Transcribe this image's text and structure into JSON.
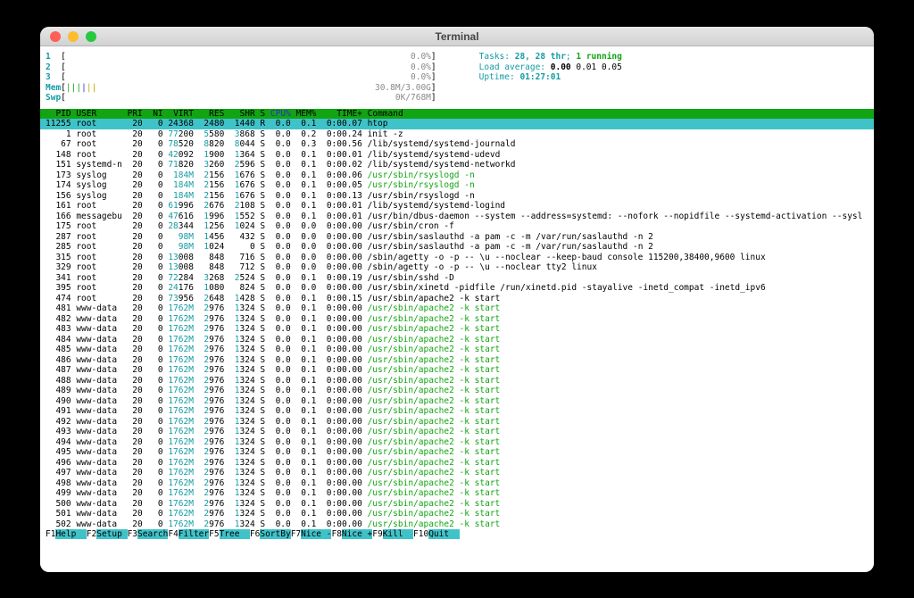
{
  "window": {
    "title": "Terminal"
  },
  "colors": {
    "green": "#13a413",
    "cyan_bg": "#3fc3c9",
    "cyan": "#149ba4",
    "gray": "#8a8a8a",
    "blue": "#2b2bd5",
    "yellow": "#c7a400",
    "t_red": "#ff5f57",
    "t_yellow": "#febc2e",
    "t_green": "#28c840"
  },
  "meters": {
    "cpus": [
      {
        "label": "1",
        "value": "0.0%"
      },
      {
        "label": "2",
        "value": "0.0%"
      },
      {
        "label": "3",
        "value": "0.0%"
      }
    ],
    "mem": {
      "label": "Mem",
      "value": "30.8M/3.00G",
      "bars": [
        "green",
        "green",
        "green",
        "blue",
        "yellow",
        "yellow"
      ]
    },
    "swp": {
      "label": "Swp",
      "value": "0K/768M",
      "bars": []
    },
    "tasks": {
      "label": "Tasks: ",
      "count": "28, 28 thr",
      "sep": "; ",
      "running": "1 running"
    },
    "load": {
      "label": "Load average: ",
      "first": "0.00 ",
      "rest": "0.01 0.05"
    },
    "uptime": {
      "label": "Uptime: ",
      "value": "01:27:01"
    }
  },
  "table": {
    "sort_column": "cpu",
    "columns": [
      {
        "key": "pid",
        "label": "PID"
      },
      {
        "key": "user",
        "label": "USER"
      },
      {
        "key": "pri",
        "label": "PRI"
      },
      {
        "key": "ni",
        "label": "NI"
      },
      {
        "key": "virt",
        "label": "VIRT"
      },
      {
        "key": "res",
        "label": "RES"
      },
      {
        "key": "shr",
        "label": "SHR"
      },
      {
        "key": "s",
        "label": "S"
      },
      {
        "key": "cpu",
        "label": "CPU%"
      },
      {
        "key": "mem",
        "label": "MEM%"
      },
      {
        "key": "time",
        "label": "TIME+"
      },
      {
        "key": "cmd",
        "label": "Command"
      }
    ],
    "rows": [
      {
        "pid": "11255",
        "user": "root",
        "pri": "20",
        "ni": "0",
        "virt": "24368",
        "res": "2480",
        "shr": "1440",
        "s": "R",
        "cpu": "0.0",
        "mem": "0.1",
        "time": "0:00.07",
        "cmd": "htop",
        "selected": true
      },
      {
        "pid": "1",
        "user": "root",
        "pri": "20",
        "ni": "0",
        "virt": "77200",
        "res": "5580",
        "shr": "3868",
        "s": "S",
        "cpu": "0.0",
        "mem": "0.2",
        "time": "0:00.24",
        "cmd": "init -z"
      },
      {
        "pid": "67",
        "user": "root",
        "pri": "20",
        "ni": "0",
        "virt": "78520",
        "res": "8820",
        "shr": "8044",
        "s": "S",
        "cpu": "0.0",
        "mem": "0.3",
        "time": "0:00.56",
        "cmd": "/lib/systemd/systemd-journald"
      },
      {
        "pid": "148",
        "user": "root",
        "pri": "20",
        "ni": "0",
        "virt": "42092",
        "res": "1900",
        "shr": "1364",
        "s": "S",
        "cpu": "0.0",
        "mem": "0.1",
        "time": "0:00.01",
        "cmd": "/lib/systemd/systemd-udevd"
      },
      {
        "pid": "151",
        "user": "systemd-n",
        "pri": "20",
        "ni": "0",
        "virt": "71820",
        "res": "3260",
        "shr": "2596",
        "s": "S",
        "cpu": "0.0",
        "mem": "0.1",
        "time": "0:00.02",
        "cmd": "/lib/systemd/systemd-networkd"
      },
      {
        "pid": "173",
        "user": "syslog",
        "pri": "20",
        "ni": "0",
        "virt": "184M",
        "res": "2156",
        "shr": "1676",
        "s": "S",
        "cpu": "0.0",
        "mem": "0.1",
        "time": "0:00.06",
        "cmd": "/usr/sbin/rsyslogd -n",
        "cmd_green": true
      },
      {
        "pid": "174",
        "user": "syslog",
        "pri": "20",
        "ni": "0",
        "virt": "184M",
        "res": "2156",
        "shr": "1676",
        "s": "S",
        "cpu": "0.0",
        "mem": "0.1",
        "time": "0:00.05",
        "cmd": "/usr/sbin/rsyslogd -n",
        "cmd_green": true
      },
      {
        "pid": "156",
        "user": "syslog",
        "pri": "20",
        "ni": "0",
        "virt": "184M",
        "res": "2156",
        "shr": "1676",
        "s": "S",
        "cpu": "0.0",
        "mem": "0.1",
        "time": "0:00.13",
        "cmd": "/usr/sbin/rsyslogd -n"
      },
      {
        "pid": "161",
        "user": "root",
        "pri": "20",
        "ni": "0",
        "virt": "61996",
        "res": "2676",
        "shr": "2108",
        "s": "S",
        "cpu": "0.0",
        "mem": "0.1",
        "time": "0:00.01",
        "cmd": "/lib/systemd/systemd-logind"
      },
      {
        "pid": "166",
        "user": "messagebu",
        "pri": "20",
        "ni": "0",
        "virt": "47616",
        "res": "1996",
        "shr": "1552",
        "s": "S",
        "cpu": "0.0",
        "mem": "0.1",
        "time": "0:00.01",
        "cmd": "/usr/bin/dbus-daemon --system --address=systemd: --nofork --nopidfile --systemd-activation --sysl"
      },
      {
        "pid": "175",
        "user": "root",
        "pri": "20",
        "ni": "0",
        "virt": "28344",
        "res": "1256",
        "shr": "1024",
        "s": "S",
        "cpu": "0.0",
        "mem": "0.0",
        "time": "0:00.00",
        "cmd": "/usr/sbin/cron -f"
      },
      {
        "pid": "287",
        "user": "root",
        "pri": "20",
        "ni": "0",
        "virt": "98M",
        "res": "1456",
        "shr": "432",
        "s": "S",
        "cpu": "0.0",
        "mem": "0.0",
        "time": "0:00.00",
        "cmd": "/usr/sbin/saslauthd -a pam -c -m /var/run/saslauthd -n 2"
      },
      {
        "pid": "285",
        "user": "root",
        "pri": "20",
        "ni": "0",
        "virt": "98M",
        "res": "1024",
        "shr": "0",
        "s": "S",
        "cpu": "0.0",
        "mem": "0.0",
        "time": "0:00.00",
        "cmd": "/usr/sbin/saslauthd -a pam -c -m /var/run/saslauthd -n 2"
      },
      {
        "pid": "315",
        "user": "root",
        "pri": "20",
        "ni": "0",
        "virt": "13008",
        "res": "848",
        "shr": "716",
        "s": "S",
        "cpu": "0.0",
        "mem": "0.0",
        "time": "0:00.00",
        "cmd": "/sbin/agetty -o -p -- \\u --noclear --keep-baud console 115200,38400,9600 linux"
      },
      {
        "pid": "329",
        "user": "root",
        "pri": "20",
        "ni": "0",
        "virt": "13008",
        "res": "848",
        "shr": "712",
        "s": "S",
        "cpu": "0.0",
        "mem": "0.0",
        "time": "0:00.00",
        "cmd": "/sbin/agetty -o -p -- \\u --noclear tty2 linux"
      },
      {
        "pid": "341",
        "user": "root",
        "pri": "20",
        "ni": "0",
        "virt": "72284",
        "res": "3268",
        "shr": "2524",
        "s": "S",
        "cpu": "0.0",
        "mem": "0.1",
        "time": "0:00.19",
        "cmd": "/usr/sbin/sshd -D"
      },
      {
        "pid": "395",
        "user": "root",
        "pri": "20",
        "ni": "0",
        "virt": "24176",
        "res": "1080",
        "shr": "824",
        "s": "S",
        "cpu": "0.0",
        "mem": "0.0",
        "time": "0:00.00",
        "cmd": "/usr/sbin/xinetd -pidfile /run/xinetd.pid -stayalive -inetd_compat -inetd_ipv6"
      },
      {
        "pid": "474",
        "user": "root",
        "pri": "20",
        "ni": "0",
        "virt": "73956",
        "res": "2648",
        "shr": "1428",
        "s": "S",
        "cpu": "0.0",
        "mem": "0.1",
        "time": "0:00.15",
        "cmd": "/usr/sbin/apache2 -k start"
      },
      {
        "pid": "481",
        "user": "www-data",
        "pri": "20",
        "ni": "0",
        "virt": "1762M",
        "res": "2976",
        "shr": "1324",
        "s": "S",
        "cpu": "0.0",
        "mem": "0.1",
        "time": "0:00.00",
        "cmd": "/usr/sbin/apache2 -k start",
        "cmd_green": true
      },
      {
        "pid": "482",
        "user": "www-data",
        "pri": "20",
        "ni": "0",
        "virt": "1762M",
        "res": "2976",
        "shr": "1324",
        "s": "S",
        "cpu": "0.0",
        "mem": "0.1",
        "time": "0:00.00",
        "cmd": "/usr/sbin/apache2 -k start",
        "cmd_green": true
      },
      {
        "pid": "483",
        "user": "www-data",
        "pri": "20",
        "ni": "0",
        "virt": "1762M",
        "res": "2976",
        "shr": "1324",
        "s": "S",
        "cpu": "0.0",
        "mem": "0.1",
        "time": "0:00.00",
        "cmd": "/usr/sbin/apache2 -k start",
        "cmd_green": true
      },
      {
        "pid": "484",
        "user": "www-data",
        "pri": "20",
        "ni": "0",
        "virt": "1762M",
        "res": "2976",
        "shr": "1324",
        "s": "S",
        "cpu": "0.0",
        "mem": "0.1",
        "time": "0:00.00",
        "cmd": "/usr/sbin/apache2 -k start",
        "cmd_green": true
      },
      {
        "pid": "485",
        "user": "www-data",
        "pri": "20",
        "ni": "0",
        "virt": "1762M",
        "res": "2976",
        "shr": "1324",
        "s": "S",
        "cpu": "0.0",
        "mem": "0.1",
        "time": "0:00.00",
        "cmd": "/usr/sbin/apache2 -k start",
        "cmd_green": true
      },
      {
        "pid": "486",
        "user": "www-data",
        "pri": "20",
        "ni": "0",
        "virt": "1762M",
        "res": "2976",
        "shr": "1324",
        "s": "S",
        "cpu": "0.0",
        "mem": "0.1",
        "time": "0:00.00",
        "cmd": "/usr/sbin/apache2 -k start",
        "cmd_green": true
      },
      {
        "pid": "487",
        "user": "www-data",
        "pri": "20",
        "ni": "0",
        "virt": "1762M",
        "res": "2976",
        "shr": "1324",
        "s": "S",
        "cpu": "0.0",
        "mem": "0.1",
        "time": "0:00.00",
        "cmd": "/usr/sbin/apache2 -k start",
        "cmd_green": true
      },
      {
        "pid": "488",
        "user": "www-data",
        "pri": "20",
        "ni": "0",
        "virt": "1762M",
        "res": "2976",
        "shr": "1324",
        "s": "S",
        "cpu": "0.0",
        "mem": "0.1",
        "time": "0:00.00",
        "cmd": "/usr/sbin/apache2 -k start",
        "cmd_green": true
      },
      {
        "pid": "489",
        "user": "www-data",
        "pri": "20",
        "ni": "0",
        "virt": "1762M",
        "res": "2976",
        "shr": "1324",
        "s": "S",
        "cpu": "0.0",
        "mem": "0.1",
        "time": "0:00.00",
        "cmd": "/usr/sbin/apache2 -k start",
        "cmd_green": true
      },
      {
        "pid": "490",
        "user": "www-data",
        "pri": "20",
        "ni": "0",
        "virt": "1762M",
        "res": "2976",
        "shr": "1324",
        "s": "S",
        "cpu": "0.0",
        "mem": "0.1",
        "time": "0:00.00",
        "cmd": "/usr/sbin/apache2 -k start",
        "cmd_green": true
      },
      {
        "pid": "491",
        "user": "www-data",
        "pri": "20",
        "ni": "0",
        "virt": "1762M",
        "res": "2976",
        "shr": "1324",
        "s": "S",
        "cpu": "0.0",
        "mem": "0.1",
        "time": "0:00.00",
        "cmd": "/usr/sbin/apache2 -k start",
        "cmd_green": true
      },
      {
        "pid": "492",
        "user": "www-data",
        "pri": "20",
        "ni": "0",
        "virt": "1762M",
        "res": "2976",
        "shr": "1324",
        "s": "S",
        "cpu": "0.0",
        "mem": "0.1",
        "time": "0:00.00",
        "cmd": "/usr/sbin/apache2 -k start",
        "cmd_green": true
      },
      {
        "pid": "493",
        "user": "www-data",
        "pri": "20",
        "ni": "0",
        "virt": "1762M",
        "res": "2976",
        "shr": "1324",
        "s": "S",
        "cpu": "0.0",
        "mem": "0.1",
        "time": "0:00.00",
        "cmd": "/usr/sbin/apache2 -k start",
        "cmd_green": true
      },
      {
        "pid": "494",
        "user": "www-data",
        "pri": "20",
        "ni": "0",
        "virt": "1762M",
        "res": "2976",
        "shr": "1324",
        "s": "S",
        "cpu": "0.0",
        "mem": "0.1",
        "time": "0:00.00",
        "cmd": "/usr/sbin/apache2 -k start",
        "cmd_green": true
      },
      {
        "pid": "495",
        "user": "www-data",
        "pri": "20",
        "ni": "0",
        "virt": "1762M",
        "res": "2976",
        "shr": "1324",
        "s": "S",
        "cpu": "0.0",
        "mem": "0.1",
        "time": "0:00.00",
        "cmd": "/usr/sbin/apache2 -k start",
        "cmd_green": true
      },
      {
        "pid": "496",
        "user": "www-data",
        "pri": "20",
        "ni": "0",
        "virt": "1762M",
        "res": "2976",
        "shr": "1324",
        "s": "S",
        "cpu": "0.0",
        "mem": "0.1",
        "time": "0:00.00",
        "cmd": "/usr/sbin/apache2 -k start",
        "cmd_green": true
      },
      {
        "pid": "497",
        "user": "www-data",
        "pri": "20",
        "ni": "0",
        "virt": "1762M",
        "res": "2976",
        "shr": "1324",
        "s": "S",
        "cpu": "0.0",
        "mem": "0.1",
        "time": "0:00.00",
        "cmd": "/usr/sbin/apache2 -k start",
        "cmd_green": true
      },
      {
        "pid": "498",
        "user": "www-data",
        "pri": "20",
        "ni": "0",
        "virt": "1762M",
        "res": "2976",
        "shr": "1324",
        "s": "S",
        "cpu": "0.0",
        "mem": "0.1",
        "time": "0:00.00",
        "cmd": "/usr/sbin/apache2 -k start",
        "cmd_green": true
      },
      {
        "pid": "499",
        "user": "www-data",
        "pri": "20",
        "ni": "0",
        "virt": "1762M",
        "res": "2976",
        "shr": "1324",
        "s": "S",
        "cpu": "0.0",
        "mem": "0.1",
        "time": "0:00.00",
        "cmd": "/usr/sbin/apache2 -k start",
        "cmd_green": true
      },
      {
        "pid": "500",
        "user": "www-data",
        "pri": "20",
        "ni": "0",
        "virt": "1762M",
        "res": "2976",
        "shr": "1324",
        "s": "S",
        "cpu": "0.0",
        "mem": "0.1",
        "time": "0:00.00",
        "cmd": "/usr/sbin/apache2 -k start",
        "cmd_green": true
      },
      {
        "pid": "501",
        "user": "www-data",
        "pri": "20",
        "ni": "0",
        "virt": "1762M",
        "res": "2976",
        "shr": "1324",
        "s": "S",
        "cpu": "0.0",
        "mem": "0.1",
        "time": "0:00.00",
        "cmd": "/usr/sbin/apache2 -k start",
        "cmd_green": true
      },
      {
        "pid": "502",
        "user": "www-data",
        "pri": "20",
        "ni": "0",
        "virt": "1762M",
        "res": "2976",
        "shr": "1324",
        "s": "S",
        "cpu": "0.0",
        "mem": "0.1",
        "time": "0:00.00",
        "cmd": "/usr/sbin/apache2 -k start",
        "cmd_green": true
      }
    ]
  },
  "fkeys": [
    {
      "key": "F1",
      "label": "Help"
    },
    {
      "key": "F2",
      "label": "Setup"
    },
    {
      "key": "F3",
      "label": "Search"
    },
    {
      "key": "F4",
      "label": "Filter"
    },
    {
      "key": "F5",
      "label": "Tree"
    },
    {
      "key": "F6",
      "label": "SortBy"
    },
    {
      "key": "F7",
      "label": "Nice -"
    },
    {
      "key": "F8",
      "label": "Nice +"
    },
    {
      "key": "F9",
      "label": "Kill"
    },
    {
      "key": "F10",
      "label": "Quit"
    }
  ]
}
